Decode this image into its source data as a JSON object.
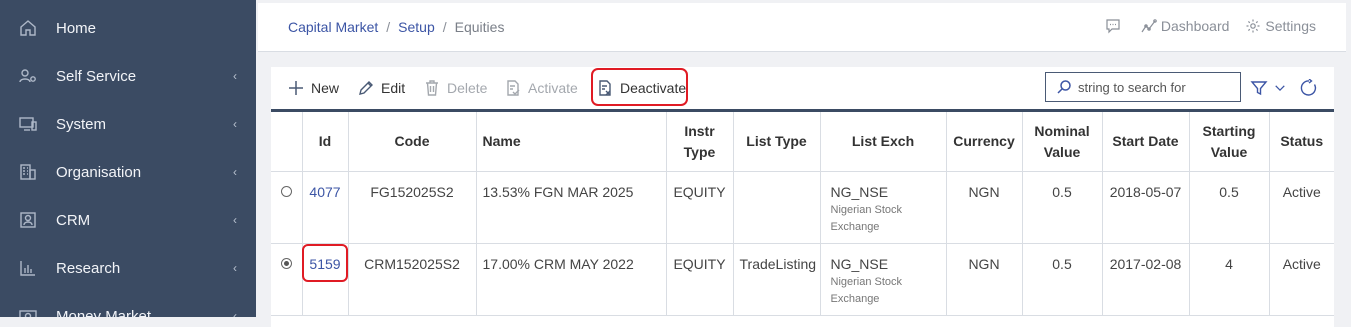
{
  "sidebar": {
    "items": [
      {
        "label": "Home",
        "icon": "home-icon",
        "chevron": false
      },
      {
        "label": "Self Service",
        "icon": "user-gear-icon",
        "chevron": true
      },
      {
        "label": "System",
        "icon": "monitor-icon",
        "chevron": true
      },
      {
        "label": "Organisation",
        "icon": "building-icon",
        "chevron": true
      },
      {
        "label": "CRM",
        "icon": "contact-card-icon",
        "chevron": true
      },
      {
        "label": "Research",
        "icon": "bar-chart-icon",
        "chevron": true
      },
      {
        "label": "Money Market",
        "icon": "money-icon",
        "chevron": true
      }
    ]
  },
  "breadcrumb": {
    "items": [
      "Capital Market",
      "Setup"
    ],
    "current": "Equities",
    "separator": "/"
  },
  "header_actions": {
    "dashboard": "Dashboard",
    "settings": "Settings"
  },
  "toolbar": {
    "new": "New",
    "edit": "Edit",
    "delete": "Delete",
    "activate": "Activate",
    "deactivate": "Deactivate",
    "search_placeholder": "string to search for"
  },
  "table": {
    "columns": [
      "",
      "Id",
      "Code",
      "Name",
      "Instr Typе",
      "List Type",
      "List Exch",
      "Currency",
      "Nominal Value",
      "Start Date",
      "Starting Value",
      "Status"
    ],
    "headers": {
      "id": "Id",
      "code": "Code",
      "name": "Name",
      "instr_type_1": "Instr",
      "instr_type_2": "Type",
      "list_type": "List Type",
      "list_exch": "List Exch",
      "currency": "Currency",
      "nominal_1": "Nominal",
      "nominal_2": "Value",
      "start_date": "Start Date",
      "starting_1": "Starting",
      "starting_2": "Value",
      "status": "Status"
    },
    "rows": [
      {
        "selected": false,
        "id": "4077",
        "code": "FG152025S2",
        "name": "13.53% FGN MAR 2025",
        "instr_type": "EQUITY",
        "list_type": "",
        "list_exch": "NG_NSE",
        "list_exch_sub_1": "Nigerian Stock",
        "list_exch_sub_2": "Exchange",
        "currency": "NGN",
        "nominal_value": "0.5",
        "start_date": "2018-05-07",
        "starting_value": "0.5",
        "status": "Active"
      },
      {
        "selected": true,
        "id": "5159",
        "code": "CRM152025S2",
        "name": "17.00% CRM MAY 2022",
        "instr_type": "EQUITY",
        "list_type": "TradeListing",
        "list_exch": "NG_NSE",
        "list_exch_sub_1": "Nigerian Stock",
        "list_exch_sub_2": "Exchange",
        "currency": "NGN",
        "nominal_value": "0.5",
        "start_date": "2017-02-08",
        "starting_value": "4",
        "status": "Active"
      }
    ]
  },
  "colors": {
    "sidebar_bg": "#3b4b63",
    "link": "#3c55a5",
    "highlight": "#e01b24"
  }
}
